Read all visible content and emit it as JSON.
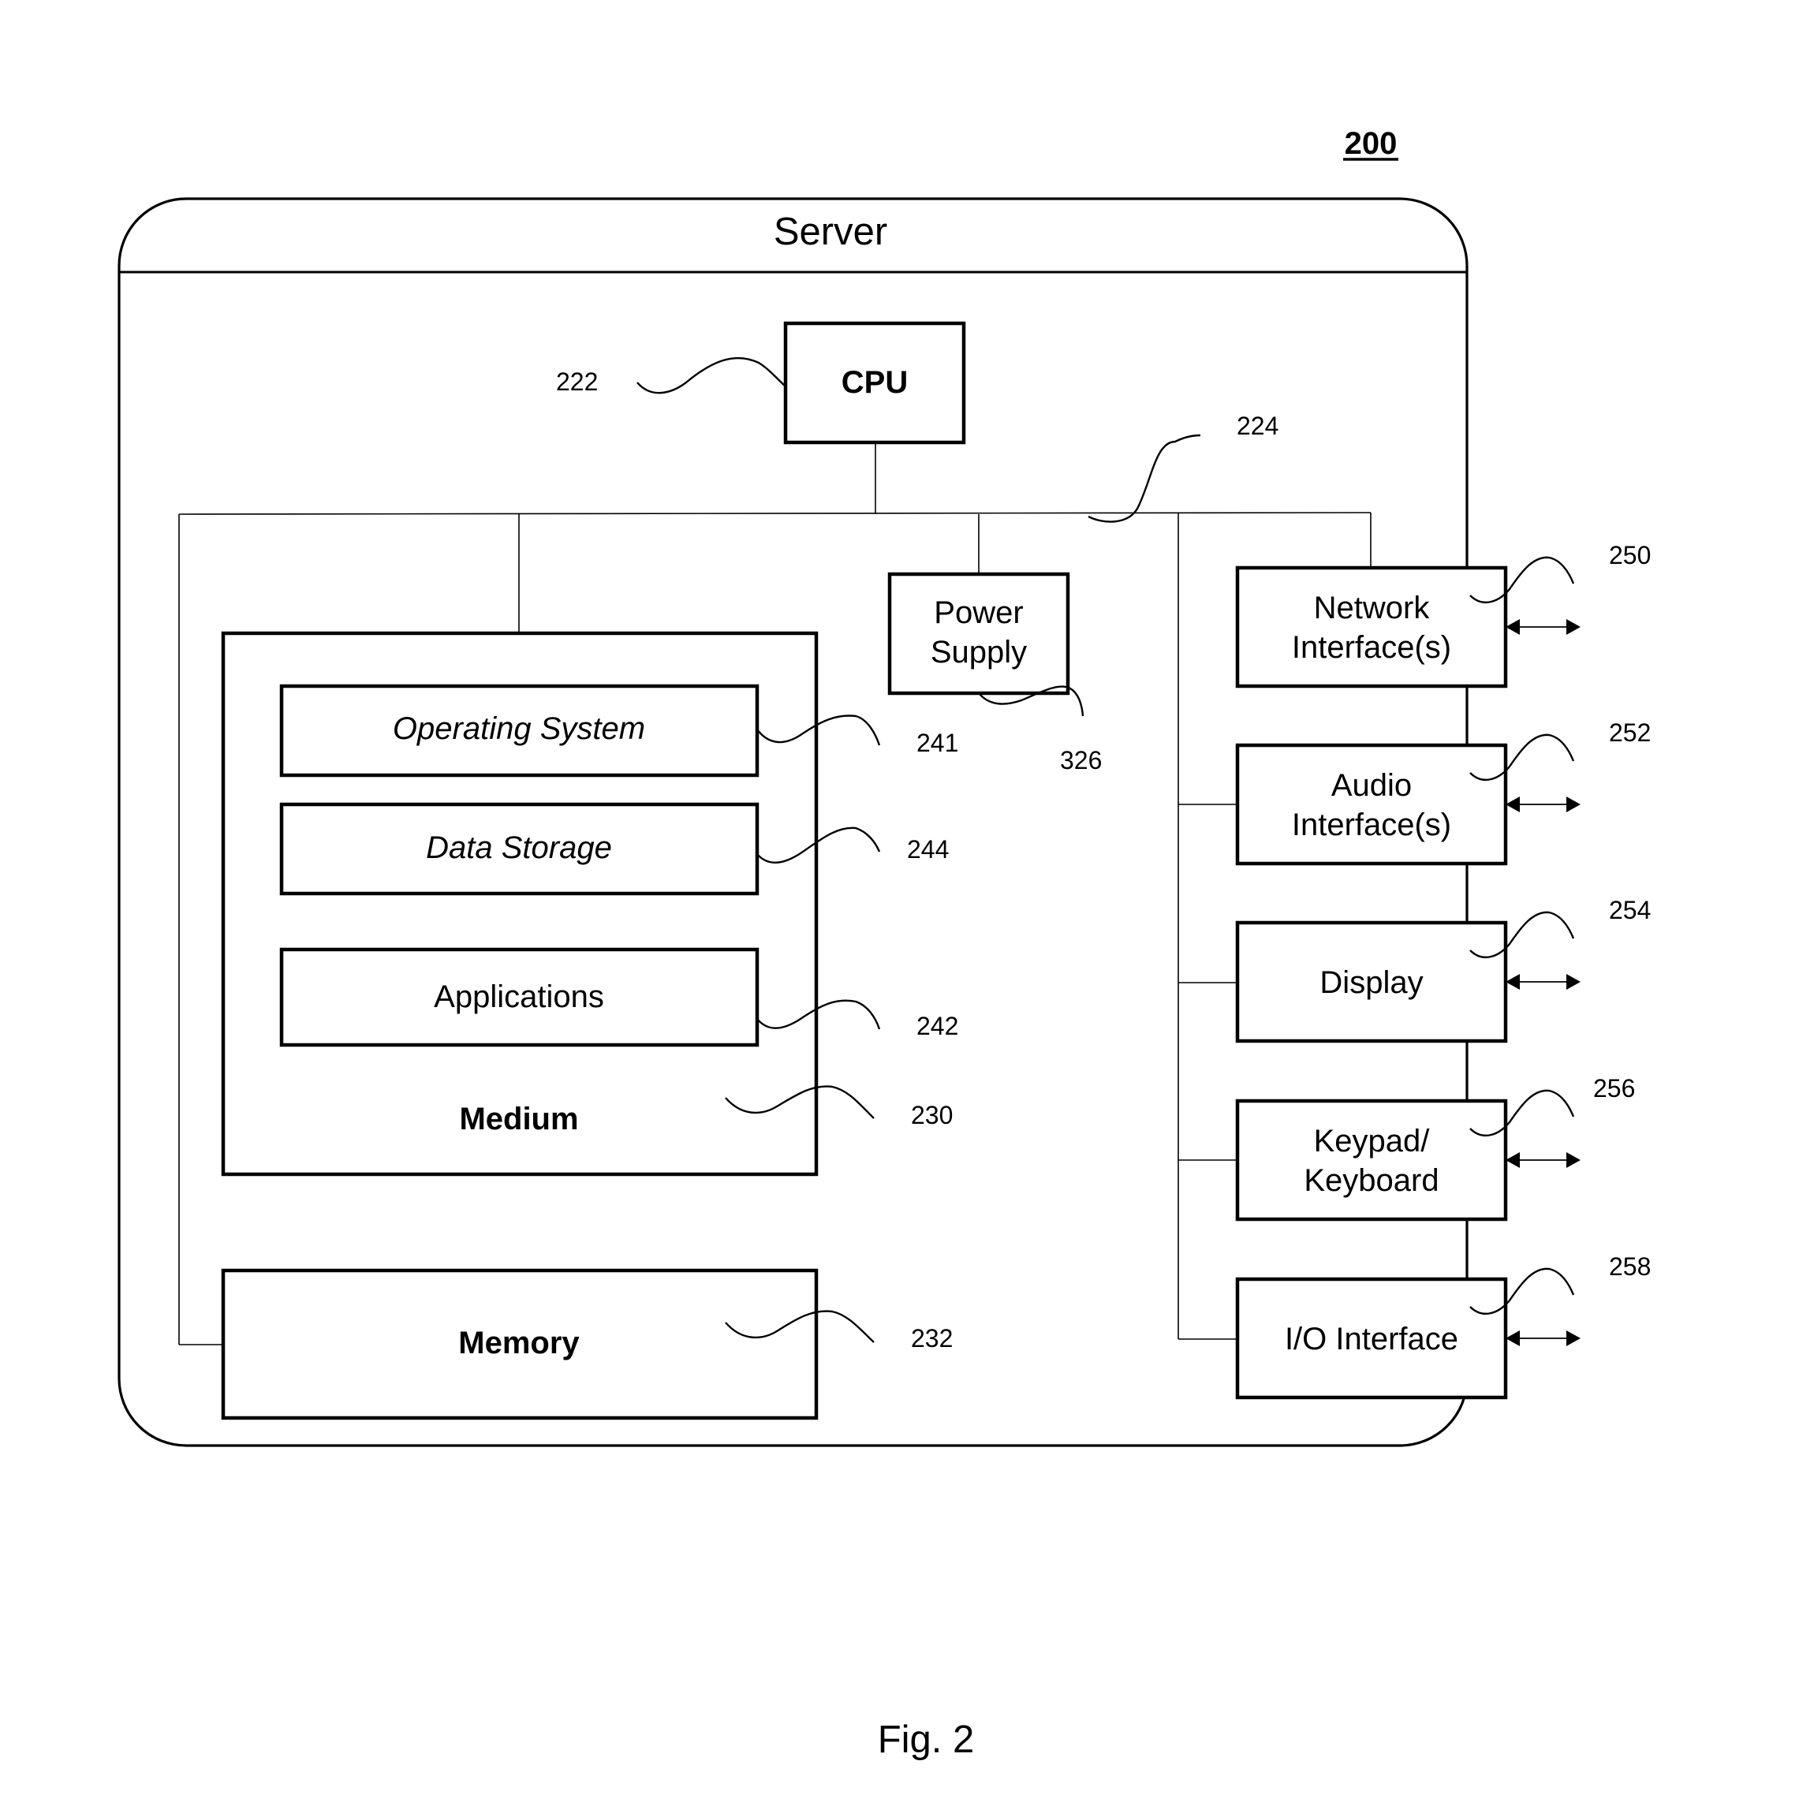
{
  "figure": {
    "number_ref": "200",
    "caption": "Fig. 2"
  },
  "server": {
    "title": "Server"
  },
  "components": {
    "cpu": {
      "label": "CPU",
      "ref": "222"
    },
    "bus": {
      "ref": "224"
    },
    "power_supply": {
      "label_lines": [
        "Power",
        "Supply"
      ],
      "ref": "326"
    },
    "medium": {
      "label": "Medium",
      "ref": "230"
    },
    "operating_system": {
      "label": "Operating System",
      "ref": "241"
    },
    "data_storage": {
      "label": "Data Storage",
      "ref": "244"
    },
    "applications": {
      "label": "Applications",
      "ref": "242"
    },
    "memory": {
      "label": "Memory",
      "ref": "232"
    },
    "network_interface": {
      "label_lines": [
        "Network",
        "Interface(s)"
      ],
      "ref": "250"
    },
    "audio_interface": {
      "label_lines": [
        "Audio",
        "Interface(s)"
      ],
      "ref": "252"
    },
    "display": {
      "label_lines": [
        "Display"
      ],
      "ref": "254"
    },
    "keypad_keyboard": {
      "label_lines": [
        "Keypad/",
        "Keyboard"
      ],
      "ref": "256"
    },
    "io_interface": {
      "label_lines": [
        "I/O Interface"
      ],
      "ref": "258"
    }
  }
}
